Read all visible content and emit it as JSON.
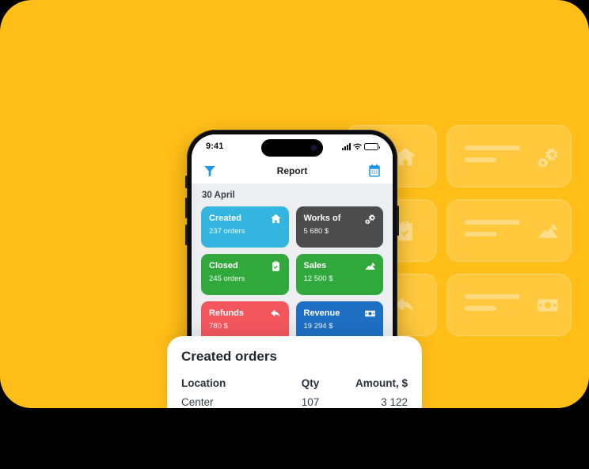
{
  "hero": {
    "background_color": "#FFBE18",
    "corner_radius_px": 40
  },
  "phone": {
    "status_bar": {
      "time": "9:41",
      "cellular_icon": "cellular-bars-icon",
      "wifi_icon": "wifi-icon",
      "battery_icon": "battery-full-icon"
    },
    "nav_bar": {
      "filter_icon": "filter-funnel-icon",
      "title": "Report",
      "calendar_icon": "calendar-icon",
      "accent_color": "#1f97e8"
    },
    "content": {
      "date_label": "30 April",
      "metrics": [
        {
          "title": "Created",
          "value": "237 orders",
          "icon": "home-icon",
          "color": "#33b5e0"
        },
        {
          "title": "Works of",
          "value": "5 680 $",
          "icon": "gears-icon",
          "color": "#4c4c4c"
        },
        {
          "title": "Closed",
          "value": "245 orders",
          "icon": "clipboard-check-icon",
          "color": "#31a83c"
        },
        {
          "title": "Sales",
          "value": "12 500 $",
          "icon": "chart-area-icon",
          "color": "#31a83c"
        },
        {
          "title": "Refunds",
          "value": "780 $",
          "icon": "reply-arrow-icon",
          "color": "#f4565e"
        },
        {
          "title": "Revenue",
          "value": "19 294 $",
          "icon": "banknote-icon",
          "color": "#1f6fc4"
        }
      ]
    }
  },
  "bottom_sheet": {
    "title": "Created orders",
    "columns": [
      "Location",
      "Qty",
      "Amount, $"
    ],
    "rows": [
      {
        "location": "Center",
        "qty": "107",
        "amount": "3 122"
      }
    ]
  },
  "ghost_cards": {
    "left_column": [
      {
        "icon": "home-icon"
      },
      {
        "icon": "clipboard-check-icon"
      },
      {
        "icon": "reply-arrow-icon"
      }
    ],
    "right_column": [
      {
        "icon": "gears-icon"
      },
      {
        "icon": "chart-area-icon"
      },
      {
        "icon": "banknote-icon"
      }
    ]
  }
}
